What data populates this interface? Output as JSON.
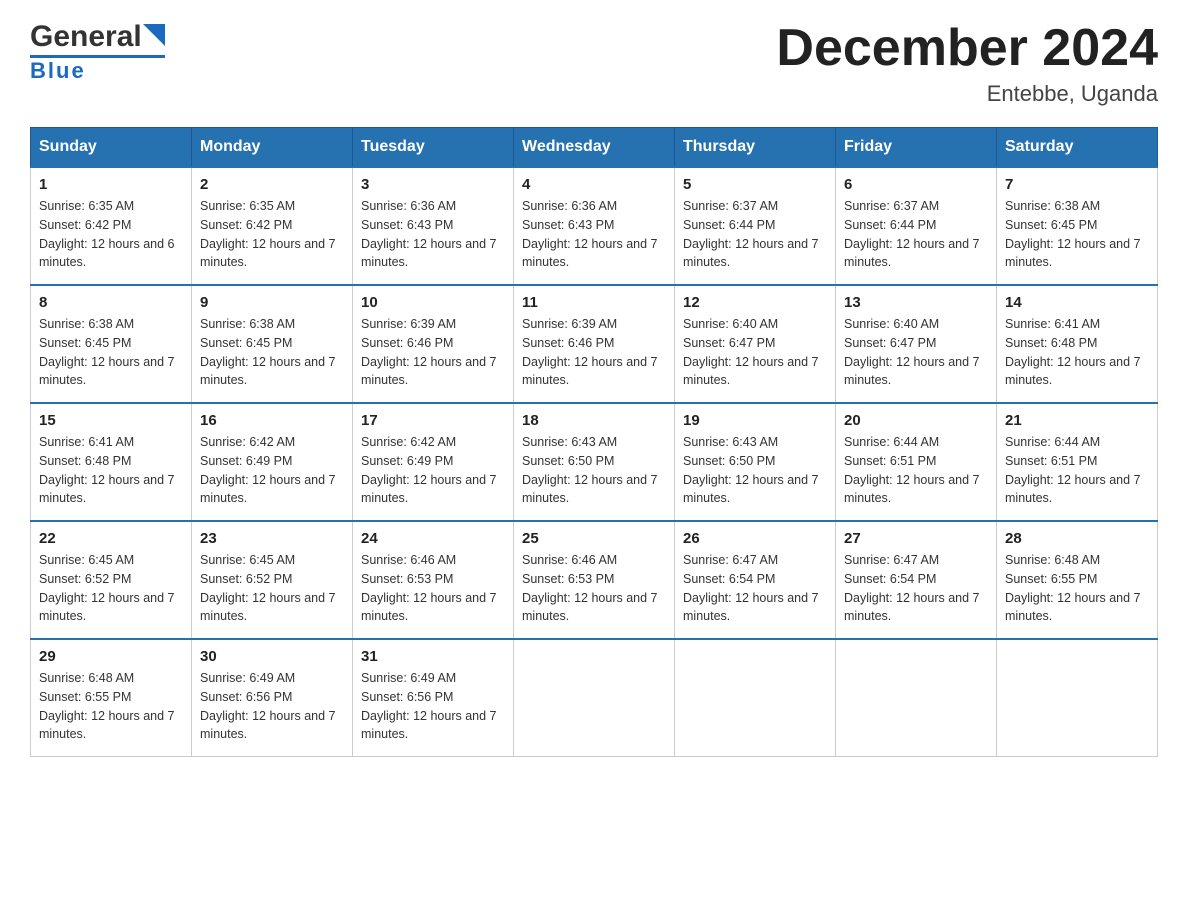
{
  "header": {
    "logo_text": "General",
    "logo_blue": "Blue",
    "month_title": "December 2024",
    "location": "Entebbe, Uganda"
  },
  "days_of_week": [
    "Sunday",
    "Monday",
    "Tuesday",
    "Wednesday",
    "Thursday",
    "Friday",
    "Saturday"
  ],
  "weeks": [
    [
      {
        "day": "1",
        "sunrise": "6:35 AM",
        "sunset": "6:42 PM",
        "daylight": "12 hours and 6 minutes."
      },
      {
        "day": "2",
        "sunrise": "6:35 AM",
        "sunset": "6:42 PM",
        "daylight": "12 hours and 7 minutes."
      },
      {
        "day": "3",
        "sunrise": "6:36 AM",
        "sunset": "6:43 PM",
        "daylight": "12 hours and 7 minutes."
      },
      {
        "day": "4",
        "sunrise": "6:36 AM",
        "sunset": "6:43 PM",
        "daylight": "12 hours and 7 minutes."
      },
      {
        "day": "5",
        "sunrise": "6:37 AM",
        "sunset": "6:44 PM",
        "daylight": "12 hours and 7 minutes."
      },
      {
        "day": "6",
        "sunrise": "6:37 AM",
        "sunset": "6:44 PM",
        "daylight": "12 hours and 7 minutes."
      },
      {
        "day": "7",
        "sunrise": "6:38 AM",
        "sunset": "6:45 PM",
        "daylight": "12 hours and 7 minutes."
      }
    ],
    [
      {
        "day": "8",
        "sunrise": "6:38 AM",
        "sunset": "6:45 PM",
        "daylight": "12 hours and 7 minutes."
      },
      {
        "day": "9",
        "sunrise": "6:38 AM",
        "sunset": "6:45 PM",
        "daylight": "12 hours and 7 minutes."
      },
      {
        "day": "10",
        "sunrise": "6:39 AM",
        "sunset": "6:46 PM",
        "daylight": "12 hours and 7 minutes."
      },
      {
        "day": "11",
        "sunrise": "6:39 AM",
        "sunset": "6:46 PM",
        "daylight": "12 hours and 7 minutes."
      },
      {
        "day": "12",
        "sunrise": "6:40 AM",
        "sunset": "6:47 PM",
        "daylight": "12 hours and 7 minutes."
      },
      {
        "day": "13",
        "sunrise": "6:40 AM",
        "sunset": "6:47 PM",
        "daylight": "12 hours and 7 minutes."
      },
      {
        "day": "14",
        "sunrise": "6:41 AM",
        "sunset": "6:48 PM",
        "daylight": "12 hours and 7 minutes."
      }
    ],
    [
      {
        "day": "15",
        "sunrise": "6:41 AM",
        "sunset": "6:48 PM",
        "daylight": "12 hours and 7 minutes."
      },
      {
        "day": "16",
        "sunrise": "6:42 AM",
        "sunset": "6:49 PM",
        "daylight": "12 hours and 7 minutes."
      },
      {
        "day": "17",
        "sunrise": "6:42 AM",
        "sunset": "6:49 PM",
        "daylight": "12 hours and 7 minutes."
      },
      {
        "day": "18",
        "sunrise": "6:43 AM",
        "sunset": "6:50 PM",
        "daylight": "12 hours and 7 minutes."
      },
      {
        "day": "19",
        "sunrise": "6:43 AM",
        "sunset": "6:50 PM",
        "daylight": "12 hours and 7 minutes."
      },
      {
        "day": "20",
        "sunrise": "6:44 AM",
        "sunset": "6:51 PM",
        "daylight": "12 hours and 7 minutes."
      },
      {
        "day": "21",
        "sunrise": "6:44 AM",
        "sunset": "6:51 PM",
        "daylight": "12 hours and 7 minutes."
      }
    ],
    [
      {
        "day": "22",
        "sunrise": "6:45 AM",
        "sunset": "6:52 PM",
        "daylight": "12 hours and 7 minutes."
      },
      {
        "day": "23",
        "sunrise": "6:45 AM",
        "sunset": "6:52 PM",
        "daylight": "12 hours and 7 minutes."
      },
      {
        "day": "24",
        "sunrise": "6:46 AM",
        "sunset": "6:53 PM",
        "daylight": "12 hours and 7 minutes."
      },
      {
        "day": "25",
        "sunrise": "6:46 AM",
        "sunset": "6:53 PM",
        "daylight": "12 hours and 7 minutes."
      },
      {
        "day": "26",
        "sunrise": "6:47 AM",
        "sunset": "6:54 PM",
        "daylight": "12 hours and 7 minutes."
      },
      {
        "day": "27",
        "sunrise": "6:47 AM",
        "sunset": "6:54 PM",
        "daylight": "12 hours and 7 minutes."
      },
      {
        "day": "28",
        "sunrise": "6:48 AM",
        "sunset": "6:55 PM",
        "daylight": "12 hours and 7 minutes."
      }
    ],
    [
      {
        "day": "29",
        "sunrise": "6:48 AM",
        "sunset": "6:55 PM",
        "daylight": "12 hours and 7 minutes."
      },
      {
        "day": "30",
        "sunrise": "6:49 AM",
        "sunset": "6:56 PM",
        "daylight": "12 hours and 7 minutes."
      },
      {
        "day": "31",
        "sunrise": "6:49 AM",
        "sunset": "6:56 PM",
        "daylight": "12 hours and 7 minutes."
      },
      null,
      null,
      null,
      null
    ]
  ]
}
